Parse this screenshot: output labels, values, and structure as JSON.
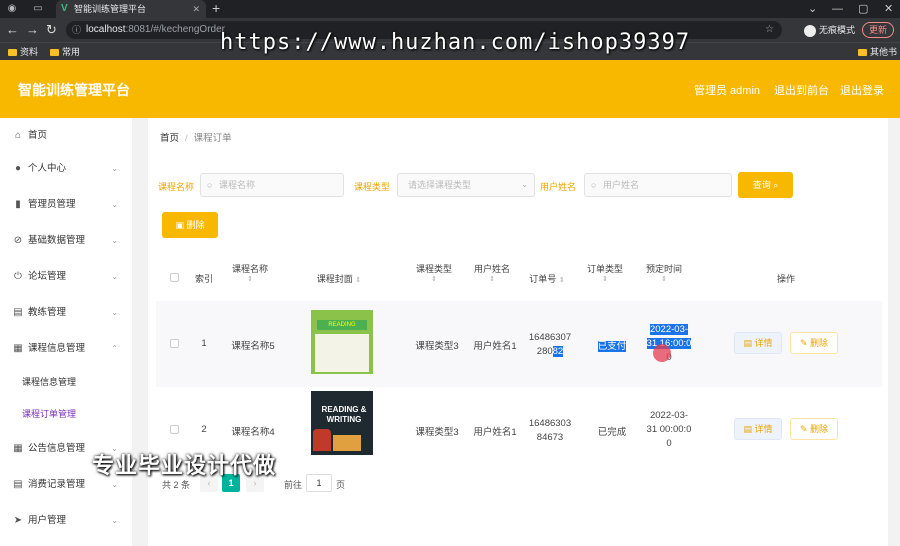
{
  "browser": {
    "tab_title": "智能训练管理平台",
    "tab_icon": "V",
    "url_host": "localhost",
    "url_rest": ":8081/#/kechengOrder",
    "incognito_label": "无痕模式",
    "update_label": "更新",
    "bookmarks": [
      "资料",
      "常用"
    ],
    "bookmarks_right": "其他书签",
    "watermark_url": "https://www.huzhan.com/ishop39397"
  },
  "header": {
    "title": "智能训练管理平台",
    "admin_label": "管理员 admin",
    "back_label": "退出到前台",
    "logout_label": "退出登录",
    "accent": "#f9b800"
  },
  "sidebar": {
    "items": [
      {
        "label": "首页",
        "icon": "home-icon"
      },
      {
        "label": "个人中心",
        "icon": "user-icon"
      },
      {
        "label": "管理员管理",
        "icon": "chart-icon"
      },
      {
        "label": "基础数据管理",
        "icon": "slash-icon"
      },
      {
        "label": "论坛管理",
        "icon": "power-icon"
      },
      {
        "label": "教练管理",
        "icon": "message-icon"
      },
      {
        "label": "课程信息管理",
        "icon": "list-icon"
      },
      {
        "label": "公告信息管理",
        "icon": "grid-icon"
      },
      {
        "label": "消费记录管理",
        "icon": "receipt-icon"
      },
      {
        "label": "用户管理",
        "icon": "send-icon"
      }
    ],
    "subitems": [
      {
        "label": "课程信息管理"
      },
      {
        "label": "课程订单管理",
        "active": true
      }
    ],
    "active_color": "#7b2fbe"
  },
  "breadcrumb": {
    "home": "首页",
    "current": "课程订单"
  },
  "search": {
    "course_name_label": "课程名称",
    "course_name_placeholder": "课程名称",
    "course_type_label": "课程类型",
    "course_type_placeholder": "请选择课程类型",
    "user_name_label": "用户姓名",
    "user_name_placeholder": "用户姓名",
    "query_label": "查询"
  },
  "actions": {
    "delete_label": "删除"
  },
  "table": {
    "headers": {
      "index": "索引",
      "course_name": "课程名称",
      "cover": "课程封面",
      "course_type": "课程类型",
      "user_name": "用户姓名",
      "order_no": "订单号",
      "order_type": "订单类型",
      "booking_time": "预定时间",
      "actions": "操作"
    },
    "rows": [
      {
        "index": "1",
        "course_name": "课程名称5",
        "course_type": "课程类型3",
        "user_name": "用户姓名1",
        "order_no_1": "16486307",
        "order_no_2a": "280",
        "order_no_2b": "82",
        "order_type": "已支付",
        "time_1": "2022-03-",
        "time_2": "31 16:00:0",
        "time_3": "0",
        "detail_label": "详情",
        "delete_label": "删除",
        "cover_text": "READING"
      },
      {
        "index": "2",
        "course_name": "课程名称4",
        "course_type": "课程类型3",
        "user_name": "用户姓名1",
        "order_no_1": "16486303",
        "order_no_2": "84673",
        "order_type": "已完成",
        "time_1": "2022-03-",
        "time_2": "31 00:00:0",
        "time_3": "0",
        "detail_label": "详情",
        "delete_label": "删除",
        "cover_text_1": "READING &",
        "cover_text_2": "WRITING"
      }
    ]
  },
  "pagination": {
    "total": "共 2 条",
    "current_page": "1",
    "goto_label": "前往",
    "goto_value": "1",
    "page_suffix": "页"
  },
  "overlay_text": "专业毕业设计代做"
}
